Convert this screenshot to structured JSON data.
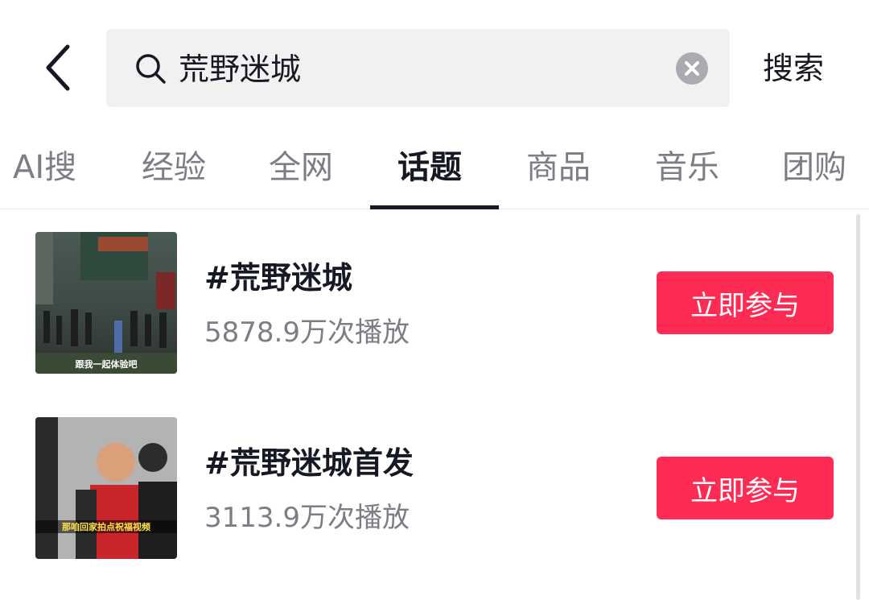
{
  "search": {
    "query": "荒野迷城",
    "submit_label": "搜索"
  },
  "tabs": [
    {
      "label": "AI搜",
      "active": false
    },
    {
      "label": "经验",
      "active": false
    },
    {
      "label": "全网",
      "active": false
    },
    {
      "label": "话题",
      "active": true
    },
    {
      "label": "商品",
      "active": false
    },
    {
      "label": "音乐",
      "active": false
    },
    {
      "label": "团购",
      "active": false
    }
  ],
  "topics": [
    {
      "title": "#荒野迷城",
      "plays": "5878.9万次播放",
      "thumb_caption": "跟我一起体验吧",
      "action_label": "立即参与"
    },
    {
      "title": "#荒野迷城首发",
      "plays": "3113.9万次播放",
      "thumb_caption": "那咱回家拍点祝福视频",
      "action_label": "立即参与"
    }
  ],
  "colors": {
    "accent": "#fe2c55",
    "text_primary": "#161823",
    "text_secondary": "#7c7e85",
    "search_bg": "#f1f1f2"
  },
  "icons": {
    "back": "chevron-left",
    "search": "magnifier",
    "clear": "circle-x"
  }
}
